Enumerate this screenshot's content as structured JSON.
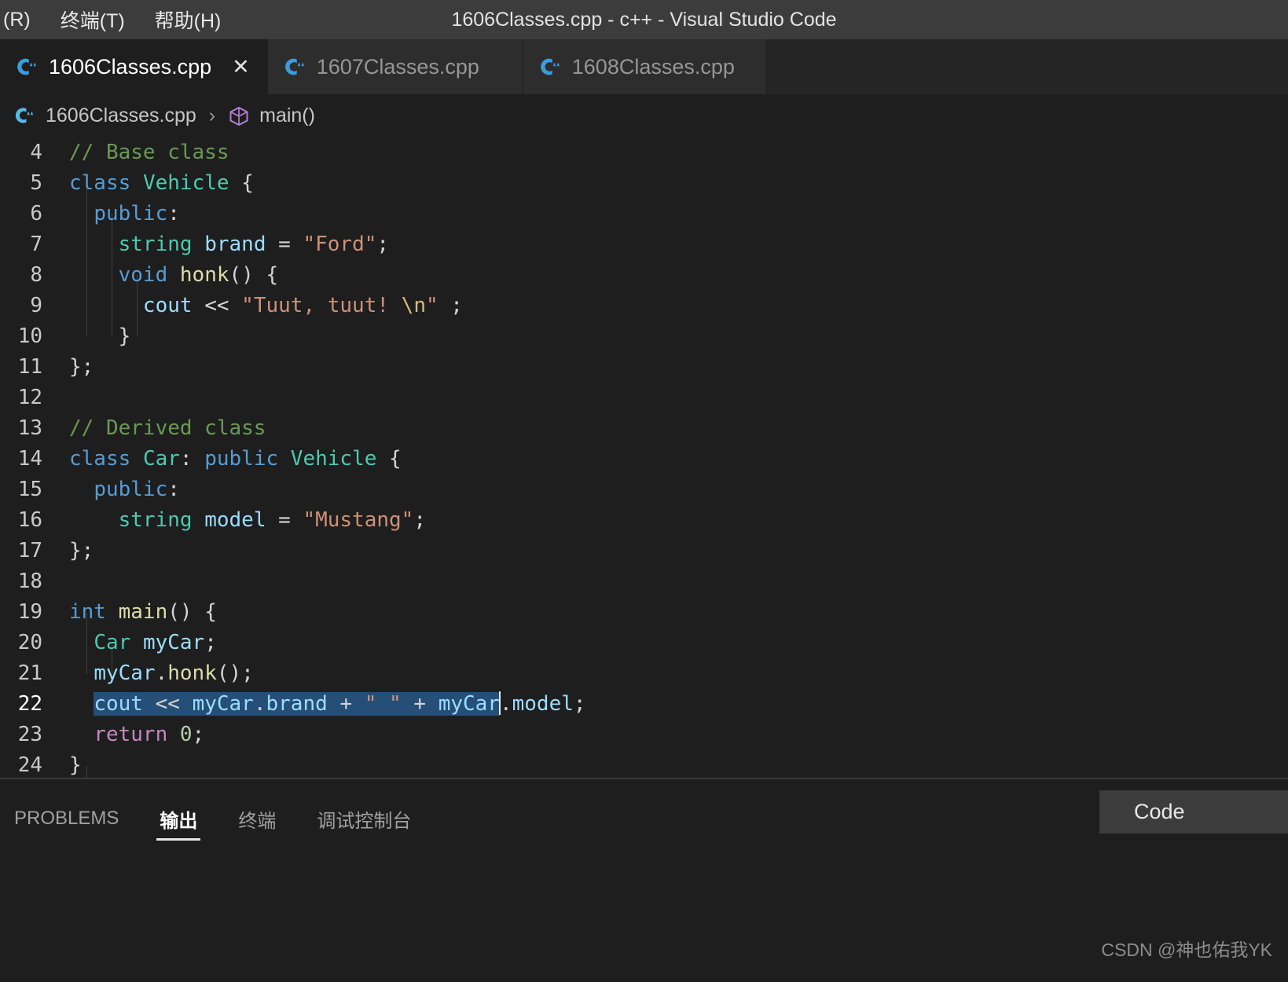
{
  "titlebar": {
    "menu": [
      {
        "label": "(R)",
        "name": "menu-run"
      },
      {
        "label": "终端(T)",
        "name": "menu-terminal"
      },
      {
        "label": "帮助(H)",
        "name": "menu-help"
      }
    ],
    "window_title": "1606Classes.cpp - c++ - Visual Studio Code"
  },
  "tabs": [
    {
      "label": "1606Classes.cpp",
      "icon": "cpp-file-icon",
      "active": true,
      "close": "✕"
    },
    {
      "label": "1607Classes.cpp",
      "icon": "cpp-file-icon",
      "active": false,
      "close": ""
    },
    {
      "label": "1608Classes.cpp",
      "icon": "cpp-file-icon",
      "active": false,
      "close": ""
    }
  ],
  "breadcrumb": {
    "file": "1606Classes.cpp",
    "separator": "›",
    "symbol": "main()"
  },
  "editor": {
    "language": "cpp",
    "first_visible_line": 4,
    "cursor_line": 22,
    "selection": {
      "line": 22,
      "text": "cout << myCar.brand + \" \" + myCar"
    },
    "lines": [
      {
        "n": "4",
        "text": "// Base class"
      },
      {
        "n": "5",
        "text": "class Vehicle {"
      },
      {
        "n": "6",
        "text": "  public:"
      },
      {
        "n": "7",
        "text": "    string brand = \"Ford\";"
      },
      {
        "n": "8",
        "text": "    void honk() {"
      },
      {
        "n": "9",
        "text": "      cout << \"Tuut, tuut! \\n\" ;"
      },
      {
        "n": "10",
        "text": "    }"
      },
      {
        "n": "11",
        "text": "};"
      },
      {
        "n": "12",
        "text": ""
      },
      {
        "n": "13",
        "text": "// Derived class"
      },
      {
        "n": "14",
        "text": "class Car: public Vehicle {"
      },
      {
        "n": "15",
        "text": "  public:"
      },
      {
        "n": "16",
        "text": "    string model = \"Mustang\";"
      },
      {
        "n": "17",
        "text": "};"
      },
      {
        "n": "18",
        "text": ""
      },
      {
        "n": "19",
        "text": "int main() {"
      },
      {
        "n": "20",
        "text": "  Car myCar;"
      },
      {
        "n": "21",
        "text": "  myCar.honk();"
      },
      {
        "n": "22",
        "text": "  cout << myCar.brand + \" \" + myCar.model;"
      },
      {
        "n": "23",
        "text": "  return 0;"
      },
      {
        "n": "24",
        "text": "}"
      }
    ]
  },
  "panel": {
    "tabs": [
      {
        "label": "PROBLEMS",
        "name": "panel-tab-problems",
        "active": false
      },
      {
        "label": "输出",
        "name": "panel-tab-output",
        "active": true
      },
      {
        "label": "终端",
        "name": "panel-tab-terminal",
        "active": false
      },
      {
        "label": "调试控制台",
        "name": "panel-tab-debug",
        "active": false
      }
    ],
    "source_selector": "Code"
  },
  "watermark": "CSDN @神也佑我YK",
  "colors": {
    "editor_bg": "#1e1e1e",
    "titlebar_bg": "#3c3c3c",
    "tabbar_bg": "#252526",
    "tab_inactive_bg": "#2d2d2d",
    "selection": "#264f78",
    "comment": "#6a9955",
    "keyword": "#569cd6",
    "type": "#4ec9b0",
    "string": "#ce9178",
    "function": "#dcdcaa",
    "variable": "#9cdcfe",
    "control": "#c586c0",
    "number": "#b5cea8",
    "escape": "#d7ba7d"
  }
}
